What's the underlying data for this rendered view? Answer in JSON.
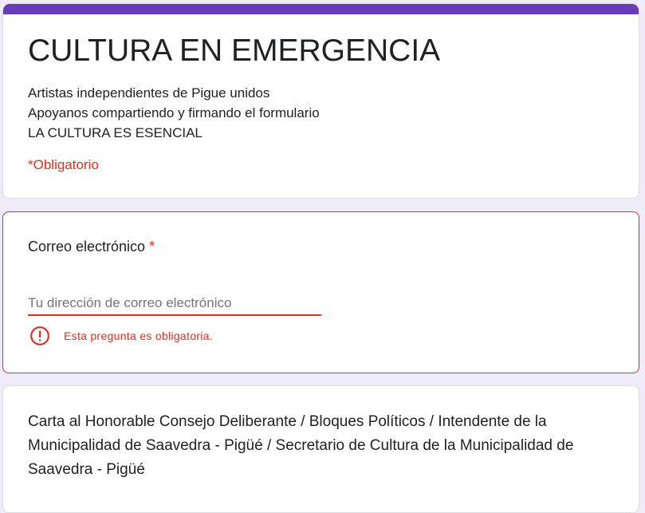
{
  "header": {
    "title": "CULTURA EN EMERGENCIA",
    "description": [
      "Artistas independientes de Pigue unidos",
      "Apoyanos compartiendo y firmando el formulario",
      "LA CULTURA ES ESENCIAL"
    ],
    "required_note": "*Obligatorio",
    "accent_color": "#673ab7"
  },
  "question": {
    "label": "Correo electrónico",
    "required_mark": "*",
    "placeholder": "Tu dirección de correo electrónico",
    "value": "",
    "error_icon": "error-circle-icon",
    "error_text": "Esta pregunta es obligatoria.",
    "error_color": "#d93025"
  },
  "letter": {
    "title": "Carta al Honorable Consejo Deliberante / Bloques Políticos / Intendente de la Municipalidad de Saavedra - Pigüé / Secretario de Cultura de la Municipalidad de Saavedra - Pigüé"
  }
}
